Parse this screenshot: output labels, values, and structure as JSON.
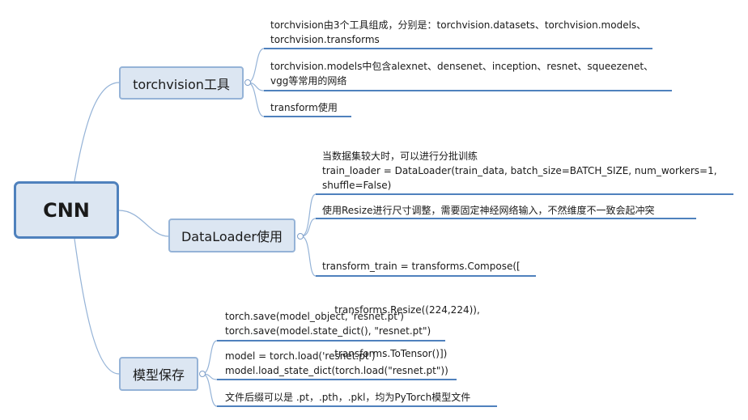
{
  "root": {
    "label": "CNN"
  },
  "branches": [
    {
      "label": "torchvision工具",
      "leaves": [
        {
          "lines": [
            "torchvision由3个工具组成，分别是：torchvision.datasets、torchvision.models、",
            "torchvision.transforms"
          ]
        },
        {
          "lines": [
            "torchvision.models中包含alexnet、densenet、inception、resnet、squeezenet、",
            "vgg等常用的网络"
          ]
        },
        {
          "lines": [
            "transform使用"
          ]
        }
      ]
    },
    {
      "label": "DataLoader使用",
      "leaves": [
        {
          "lines": [
            "当数据集较大时，可以进行分批训练",
            "train_loader = DataLoader(train_data, batch_size=BATCH_SIZE, num_workers=1,",
            "shuffle=False)"
          ]
        },
        {
          "lines": [
            "使用Resize进行尺寸调整，需要固定神经网络输入，不然维度不一致会起冲突"
          ]
        },
        {
          "lines": [
            "transform_train = transforms.Compose([",
            "    transforms.Resize((224,224)),",
            "    transforms.ToTensor()])"
          ]
        }
      ]
    },
    {
      "label": "模型保存",
      "leaves": [
        {
          "lines": [
            "torch.save(model_object, 'resnet.pt')",
            "torch.save(model.state_dict(), \"resnet.pt\")"
          ]
        },
        {
          "lines": [
            "model = torch.load('resnet.pt')",
            "model.load_state_dict(torch.load(\"resnet.pt\"))"
          ]
        },
        {
          "lines": [
            "文件后缀可以是 .pt，.pth，.pkl，均为PyTorch模型文件"
          ]
        }
      ]
    }
  ],
  "colors": {
    "node_fill": "#dce6f2",
    "node_border": "#95b3d7",
    "root_border": "#4f81bd",
    "line": "#4f81bd",
    "connector": "#95b3d7"
  }
}
